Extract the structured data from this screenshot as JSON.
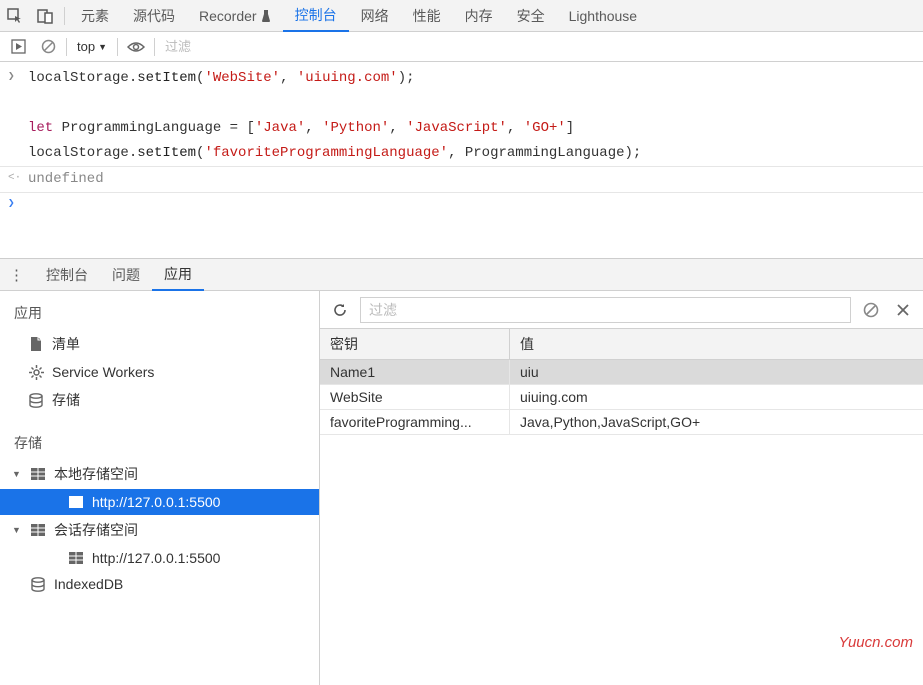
{
  "top_tabs": {
    "items": [
      "元素",
      "源代码",
      "Recorder",
      "控制台",
      "网络",
      "性能",
      "内存",
      "安全",
      "Lighthouse"
    ],
    "active_index": 3
  },
  "console_toolbar": {
    "context": "top",
    "filter_placeholder": "过滤"
  },
  "console": {
    "lines": [
      {
        "type": "in",
        "html": "localStorage.<span class='fn'>setItem</span>(<span class='str'>'WebSite'</span>, <span class='str'>'uiuing.com'</span>);"
      },
      {
        "type": "blank"
      },
      {
        "type": "cont",
        "html": "<span class='kw'>let</span> ProgrammingLanguage = [<span class='str'>'Java'</span>, <span class='str'>'Python'</span>, <span class='str'>'JavaScript'</span>, <span class='str'>'GO+'</span>]"
      },
      {
        "type": "cont",
        "html": "localStorage.<span class='fn'>setItem</span>(<span class='str'>'favoriteProgrammingLanguage'</span>, ProgrammingLanguage);"
      },
      {
        "type": "out",
        "text": "undefined"
      },
      {
        "type": "prompt"
      }
    ]
  },
  "drawer_tabs": {
    "items": [
      "控制台",
      "问题",
      "应用"
    ],
    "active_index": 2
  },
  "sidebar": {
    "section_application": "应用",
    "app_items": [
      {
        "icon": "file",
        "label": "清单"
      },
      {
        "icon": "gear",
        "label": "Service Workers"
      },
      {
        "icon": "db",
        "label": "存储"
      }
    ],
    "section_storage": "存储",
    "storage_tree": [
      {
        "expanded": true,
        "icon": "grid",
        "label": "本地存储空间",
        "children": [
          {
            "icon": "grid",
            "label": "http://127.0.0.1:5500",
            "selected": true
          }
        ]
      },
      {
        "expanded": true,
        "icon": "grid",
        "label": "会话存储空间",
        "children": [
          {
            "icon": "grid",
            "label": "http://127.0.0.1:5500"
          }
        ]
      },
      {
        "icon": "db",
        "label": "IndexedDB"
      }
    ]
  },
  "storage_panel": {
    "filter_placeholder": "过滤",
    "columns": [
      "密钥",
      "值"
    ],
    "rows": [
      {
        "key": "Name1",
        "value": "uiu",
        "selected": true
      },
      {
        "key": "WebSite",
        "value": "uiuing.com"
      },
      {
        "key": "favoriteProgramming...",
        "value": "Java,Python,JavaScript,GO+"
      }
    ]
  },
  "watermark": "Yuucn.com"
}
